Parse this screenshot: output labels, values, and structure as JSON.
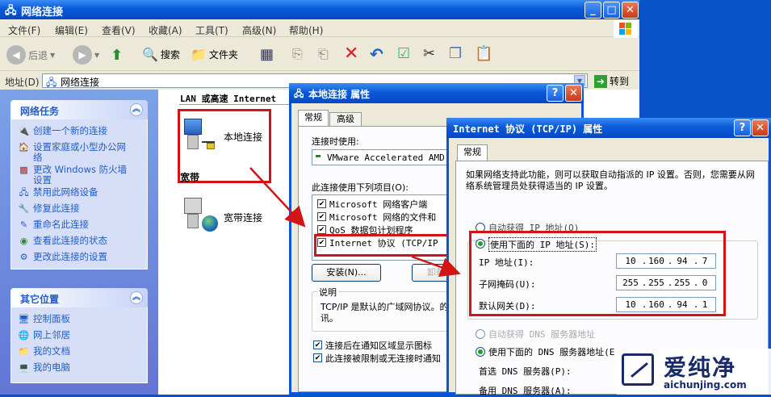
{
  "window": {
    "title": "网络连接",
    "controls": {
      "min": "_",
      "max": "□",
      "close": "✕"
    }
  },
  "menu": [
    "文件(F)",
    "编辑(E)",
    "查看(V)",
    "收藏(A)",
    "工具(T)",
    "高级(N)",
    "帮助(H)"
  ],
  "toolbar": {
    "back": "后退",
    "search": "搜索",
    "folders": "文件夹"
  },
  "address": {
    "label": "地址(D)",
    "value": "网络连接",
    "go": "转到"
  },
  "network_tasks": {
    "header": "网络任务",
    "items": [
      "创建一个新的连接",
      "设置家庭或小型办公网络",
      "更改 Windows 防火墙设置",
      "禁用此网络设备",
      "修复此连接",
      "重命名此连接",
      "查看此连接的状态",
      "更改此连接的设置"
    ]
  },
  "other_places": {
    "header": "其它位置",
    "items": [
      "控制面板",
      "网上邻居",
      "我的文档",
      "我的电脑"
    ]
  },
  "content": {
    "group_lan": "LAN 或高速 Internet",
    "lan_item": "本地连接",
    "group_broadband": "宽带",
    "broadband_item": "宽带连接"
  },
  "local_dialog": {
    "title": "本地连接 属性",
    "tabs": [
      "常规",
      "高级"
    ],
    "connect_using_label": "连接时使用:",
    "adapter": "VMware Accelerated AMD",
    "items_label": "此连接使用下列项目(O):",
    "items": [
      {
        "label": "Microsoft 网络客户端",
        "checked": true
      },
      {
        "label": "Microsoft 网络的文件和",
        "checked": true
      },
      {
        "label": "QoS 数据包计划程序",
        "checked": true
      },
      {
        "label": "Internet 协议 (TCP/IP",
        "checked": true
      }
    ],
    "install_button": "安装(N)...",
    "uninstall_button": "卸载",
    "description_label": "说明",
    "description": "TCP/IP 是默认的广域网协议。的通讯。",
    "option1": "连接后在通知区域显示图标",
    "option2": "此连接被限制或无连接时通知"
  },
  "tcpip_dialog": {
    "title": "Internet 协议 (TCP/IP) 属性",
    "tab": "常规",
    "intro": "如果网络支持此功能，则可以获取自动指派的 IP 设置。否则，您需要从网络系统管理员处获得适当的 IP 设置。",
    "auto_ip": "自动获得 IP 地址(O)",
    "use_ip": "使用下面的 IP 地址(S):",
    "ip_label": "IP 地址(I):",
    "ip_value": [
      "10",
      "160",
      "94",
      "7"
    ],
    "mask_label": "子网掩码(U):",
    "mask_value": [
      "255",
      "255",
      "255",
      "0"
    ],
    "gateway_label": "默认网关(D):",
    "gateway_value": [
      "10",
      "160",
      "94",
      "1"
    ],
    "auto_dns": "自动获得 DNS 服务器地址",
    "use_dns": "使用下面的 DNS 服务器地址(E",
    "dns1_label": "首选 DNS 服务器(P):",
    "dns2_label": "备用 DNS 服务器(A):"
  },
  "watermark": {
    "brand": "爱纯净",
    "url": "aichunjing.com"
  },
  "colors": {
    "xp_blue": "#0a5ad6",
    "highlight_red": "#d21414",
    "task_blue": "#215dc6"
  }
}
